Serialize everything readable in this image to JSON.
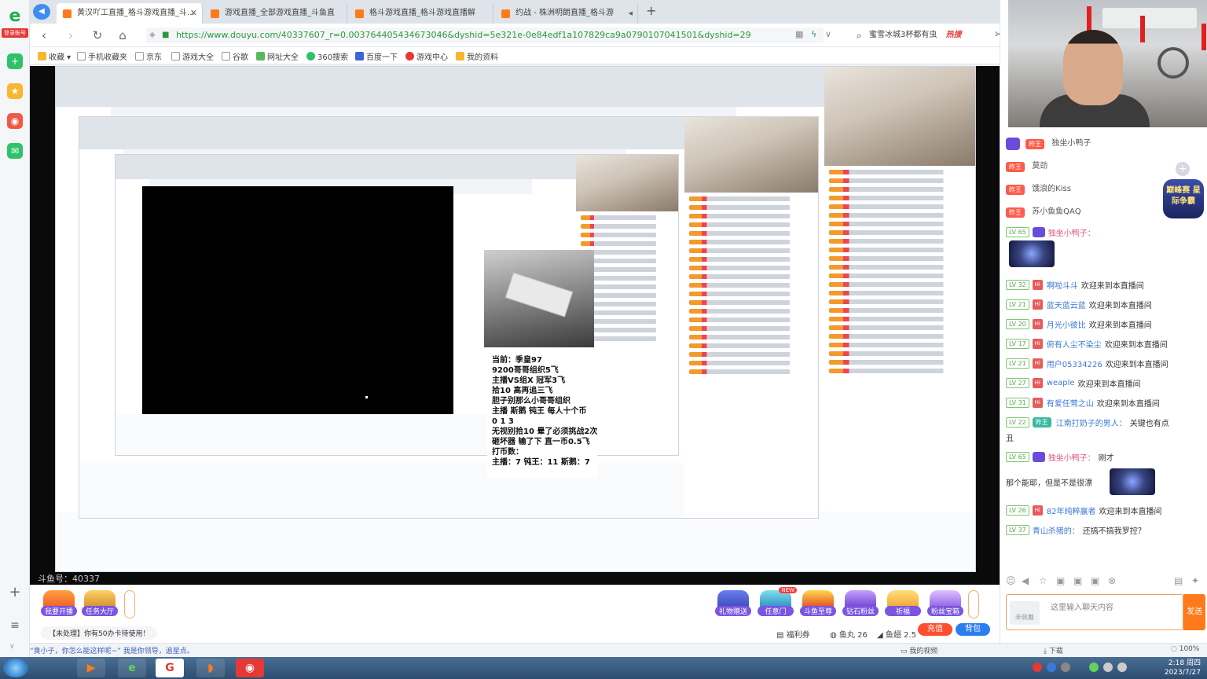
{
  "tabs": [
    {
      "label": "黄汉吖工直播_格斗游戏直播_斗..."
    },
    {
      "label": "游戏直播_全部游戏直播_斗鱼直"
    },
    {
      "label": "格斗游戏直播_格斗游戏直播解"
    },
    {
      "label": "约战 - 株洲明朗直播_格斗游"
    }
  ],
  "address": {
    "url": "https://www.douyu.com/40337607_r=0.003764405434673046&dyshid=5e321e-0e84edf1a107829ca9a0790107041501&dyshid=29",
    "search_text": "蜜雪冰城3杯都有虫",
    "search_hot": "热搜"
  },
  "bookmarks": [
    "收藏",
    "手机收藏夹",
    "京东",
    "游戏大全",
    "谷歌",
    "网址大全",
    "360搜索",
    "百度一下",
    "游戏中心",
    "我的资料"
  ],
  "left_sidebar": {
    "login": "登录账号"
  },
  "stream": {
    "overlay_lines": [
      "当前：季皇97",
      "9200哥哥组织5飞",
      "主播VS组X 冠军3飞",
      "拾10 高再追三飞",
      "",
      "胆子别那么小哥哥组织",
      "主播 斯鹅 钝王 每人十个币",
      " 0    1    3",
      "无视别拾10 晕了必须挑战2次",
      "砸坏器 输了下 直一币0.5飞",
      "打币数：",
      "主播：7 钝王：11 斯鹅：7"
    ],
    "room_label": "斗鱼号：40337"
  },
  "giftbar": {
    "buttons": [
      "我要开播",
      "任务大厅"
    ],
    "gifts": [
      "礼物赠送",
      "任意门",
      "斗鱼至尊",
      "钻石粉丝",
      "祈福",
      "粉丝宝箱"
    ],
    "new_badge": "NEW",
    "notice": "【未处理】你有50办卡待使用！",
    "welfare": "福利券",
    "fish_balls": "鱼丸 26",
    "fish_coins": "鱼翅 2.5",
    "recharge": "充值",
    "backpack": "背包"
  },
  "status_row": {
    "message": "“臭小子，你怎么能这样呢~” 我是你领导，追星点。",
    "my_video": "我的视频",
    "download": "下载",
    "zoom": "100%"
  },
  "rank_list": [
    {
      "badge": "昨王",
      "name": "独坐小鸭子"
    },
    {
      "badge": "昨王",
      "name": "莫劲"
    },
    {
      "badge": "昨王",
      "name": "饿浪的Kiss"
    },
    {
      "badge": "昨王",
      "name": "苏小鱼鱼QAQ"
    }
  ],
  "season_badge": "巅峰赛 星际争霸",
  "chat_messages": [
    {
      "lv": "LV 65",
      "user": "独坐小鸭子：",
      "text": ""
    },
    {
      "lv": "LV 32",
      "user": "啊啦斗斗",
      "text": "欢迎来到本直播间"
    },
    {
      "lv": "LV 21",
      "user": "蓝天蓝云蓝",
      "text": "欢迎来到本直播间"
    },
    {
      "lv": "LV 20",
      "user": "月光小彼比",
      "text": "欢迎来到本直播间"
    },
    {
      "lv": "LV 17",
      "user": "俯有人尘不染尘",
      "text": "欢迎来到本直播间"
    },
    {
      "lv": "LV 21",
      "user": "用户05334226",
      "text": "欢迎来到本直播间"
    },
    {
      "lv": "LV 27",
      "user": "weaple",
      "text": "欢迎来到本直播间"
    },
    {
      "lv": "LV 31",
      "user": "有爱任莺之山",
      "text": "欢迎来到本直播间"
    },
    {
      "lv": "LV 22",
      "user": "江南打奶子的男人：",
      "text": "关键也有点"
    },
    {
      "lv": "",
      "user": "",
      "text": "丑"
    },
    {
      "lv": "LV 65",
      "user": "独坐小鸭子：",
      "text": "刚才"
    },
    {
      "lv": "",
      "user": "",
      "text": "那个能耶，但是不是很漂亮"
    },
    {
      "lv": "LV 26",
      "user": "82年纯粹赢者",
      "text": "欢迎来到本直播间"
    },
    {
      "lv": "LV 37",
      "user": "青山杀猪的：",
      "text": "还搞不搞我罗控？"
    }
  ],
  "chat_input": {
    "placeholder": "这里输入聊天内容",
    "avatar_label": "未佩戴",
    "send": "发送"
  },
  "taskbar": {
    "time": "2:18 周四",
    "date": "2023/7/27"
  },
  "colors": {
    "accent": "#ff7a1a",
    "red": "#e53935",
    "link": "#3d78d8"
  }
}
